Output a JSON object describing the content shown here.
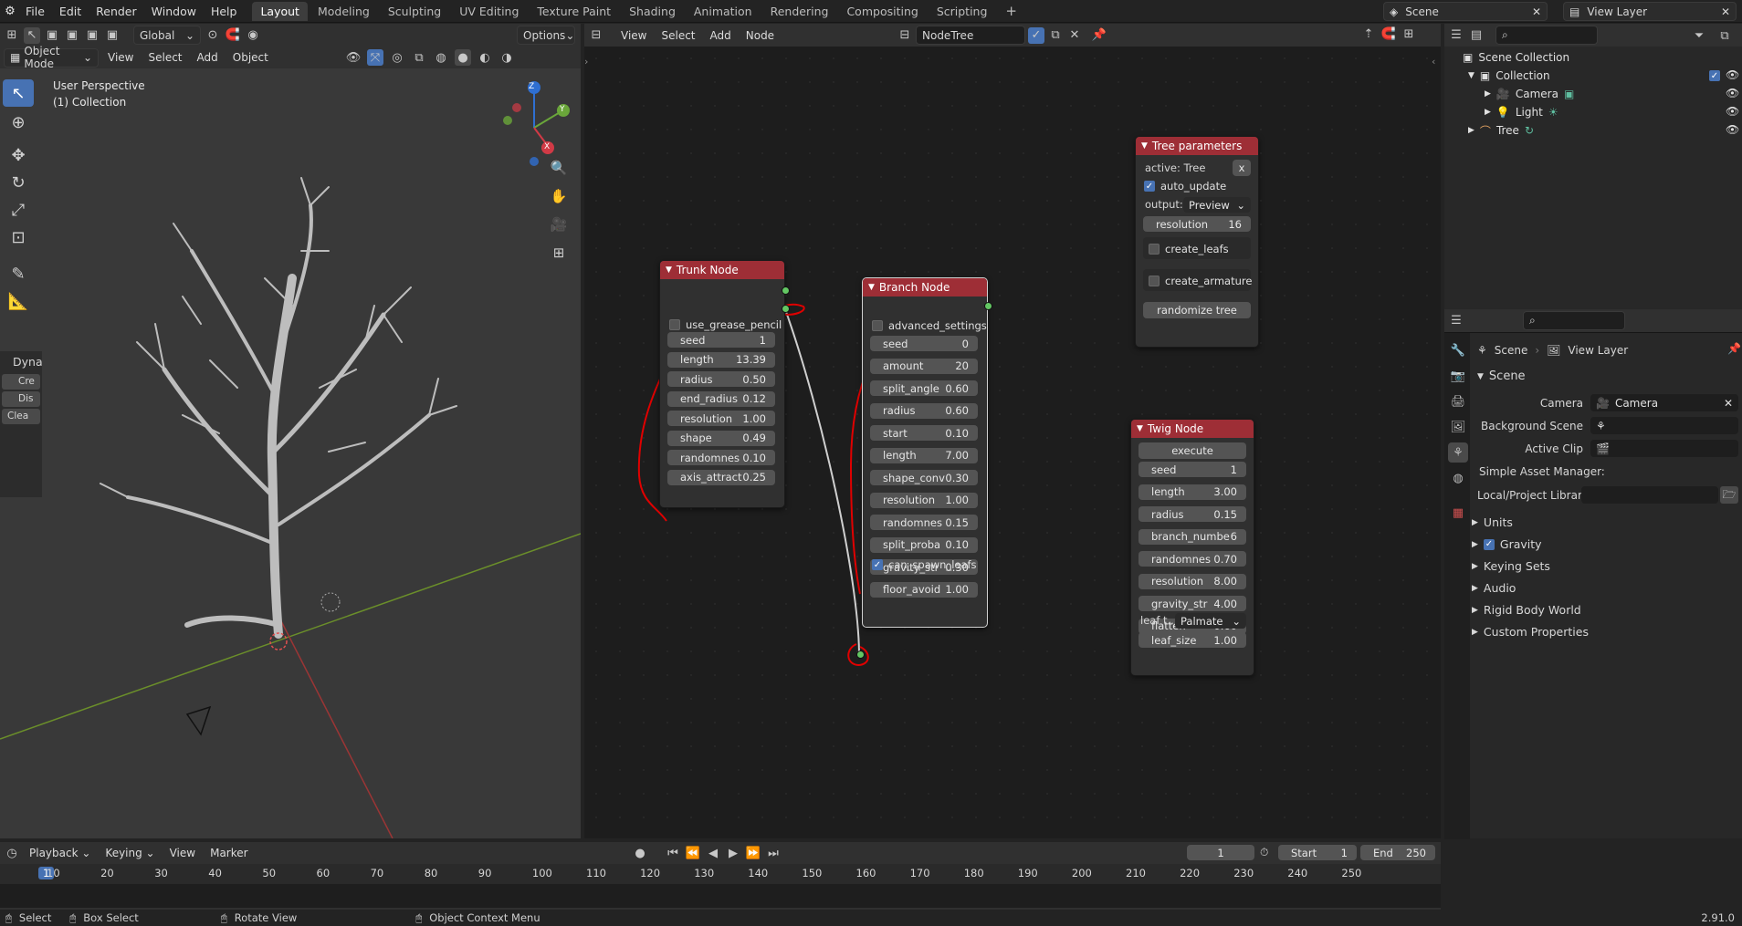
{
  "topbar": {
    "menus": [
      "File",
      "Edit",
      "Render",
      "Window",
      "Help"
    ],
    "workspaces": [
      "Layout",
      "Modeling",
      "Sculpting",
      "UV Editing",
      "Texture Paint",
      "Shading",
      "Animation",
      "Rendering",
      "Compositing",
      "Scripting"
    ],
    "active_workspace": "Layout",
    "scene": "Scene",
    "view_layer": "View Layer"
  },
  "viewport": {
    "mode": "Object Mode",
    "menus": [
      "View",
      "Select",
      "Add",
      "Object"
    ],
    "transform_orientation": "Global",
    "options_label": "Options",
    "overlay_title": "User Perspective",
    "overlay_subtitle": "(1) Collection",
    "sidebar_tab": "Dyna",
    "sidebar_buttons": [
      "Cre",
      "Dis",
      "Clea"
    ],
    "gizmo_axes": [
      "X",
      "Y",
      "Z"
    ]
  },
  "node_editor": {
    "menus": [
      "View",
      "Select",
      "Add",
      "Node"
    ],
    "tree_name": "NodeTree",
    "trunk_node": {
      "title": "Trunk Node",
      "checkbox": "use_grease_pencil",
      "fields": [
        {
          "label": "seed",
          "value": "1"
        },
        {
          "label": "length",
          "value": "13.39"
        },
        {
          "label": "radius",
          "value": "0.50"
        },
        {
          "label": "end_radius",
          "value": "0.12"
        },
        {
          "label": "resolution",
          "value": "1.00"
        },
        {
          "label": "shape",
          "value": "0.49"
        },
        {
          "label": "randomnes",
          "value": "0.10"
        },
        {
          "label": "axis_attract",
          "value": "0.25"
        }
      ]
    },
    "branch_node": {
      "title": "Branch Node",
      "checkbox": "advanced_settings",
      "fields": [
        {
          "label": "seed",
          "value": "0"
        },
        {
          "label": "amount",
          "value": "20"
        },
        {
          "label": "split_angle",
          "value": "0.60"
        },
        {
          "label": "radius",
          "value": "0.60"
        },
        {
          "label": "start",
          "value": "0.10"
        },
        {
          "label": "length",
          "value": "7.00"
        },
        {
          "label": "shape_conv",
          "value": "0.30"
        },
        {
          "label": "resolution",
          "value": "1.00"
        },
        {
          "label": "randomnes",
          "value": "0.15"
        },
        {
          "label": "split_proba",
          "value": "0.10"
        },
        {
          "label": "gravity_str",
          "value": "0.30"
        },
        {
          "label": "floor_avoid",
          "value": "1.00"
        }
      ],
      "bottom_checkbox": "can_spawn_leafs"
    },
    "tree_params": {
      "title": "Tree parameters",
      "active_label": "active: Tree",
      "close": "x",
      "auto_update": "auto_update",
      "output_label": "output:",
      "output_value": "Preview",
      "resolution_label": "resolution",
      "resolution_value": "16",
      "create_leafs": "create_leafs",
      "create_armature": "create_armature",
      "randomize": "randomize tree"
    },
    "twig_node": {
      "title": "Twig Node",
      "execute": "execute",
      "fields": [
        {
          "label": "seed",
          "value": "1"
        },
        {
          "label": "length",
          "value": "3.00"
        },
        {
          "label": "radius",
          "value": "0.15"
        },
        {
          "label": "branch_numbe",
          "value": "6"
        },
        {
          "label": "randomnes",
          "value": "0.70"
        },
        {
          "label": "resolution",
          "value": "8.00"
        },
        {
          "label": "gravity_str",
          "value": "4.00"
        },
        {
          "label": "flatten",
          "value": "0.60"
        }
      ],
      "leaf_type_label": "leaf t...",
      "leaf_type_value": "Palmate",
      "leaf_size_label": "leaf_size",
      "leaf_size_value": "1.00"
    }
  },
  "outliner": {
    "items": [
      "Scene Collection",
      "Collection",
      "Camera",
      "Light",
      "Tree"
    ]
  },
  "properties": {
    "breadcrumb_scene": "Scene",
    "breadcrumb_layer": "View Layer",
    "section": "Scene",
    "camera_label": "Camera",
    "camera_value": "Camera",
    "bg_scene_label": "Background Scene",
    "active_clip_label": "Active Clip",
    "asset_manager": "Simple Asset Manager:",
    "library_label": "Local/Project Librar...",
    "panels": [
      "Units",
      "Gravity",
      "Keying Sets",
      "Audio",
      "Rigid Body World",
      "Custom Properties"
    ]
  },
  "timeline": {
    "menus": [
      "Playback",
      "Keying",
      "View",
      "Marker"
    ],
    "current_frame": "1",
    "start_label": "Start",
    "start_value": "1",
    "end_label": "End",
    "end_value": "250",
    "ruler": [
      "1",
      "10",
      "20",
      "30",
      "40",
      "50",
      "60",
      "70",
      "80",
      "90",
      "100",
      "110",
      "120",
      "130",
      "140",
      "150",
      "160",
      "170",
      "180",
      "190",
      "200",
      "210",
      "220",
      "230",
      "240",
      "250"
    ]
  },
  "statusbar": {
    "select": "Select",
    "box_select": "Box Select",
    "rotate_view": "Rotate View",
    "context_menu": "Object Context Menu",
    "version": "2.91.0"
  },
  "colors": {
    "accent": "#4772b3",
    "node_header": "#9e2e36",
    "socket": "#63c763",
    "annotation": "#e00000"
  }
}
